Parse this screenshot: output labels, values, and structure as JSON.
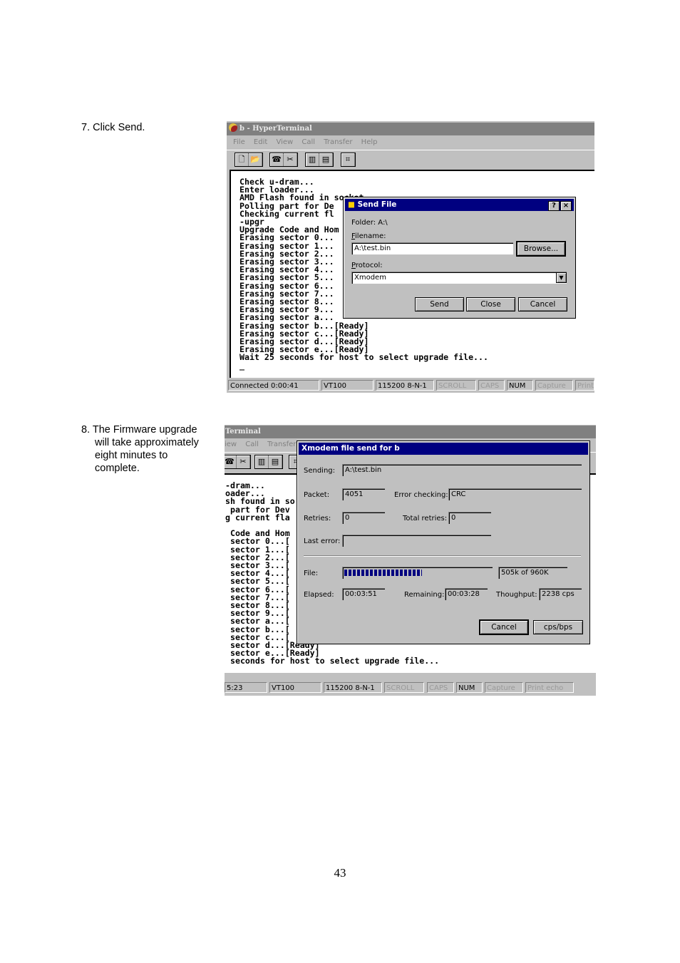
{
  "steps": {
    "step7": "7. Click Send.",
    "step8_line1": "8. The Firmware upgrade",
    "step8_line2": "will take approximately",
    "step8_line3": "eight minutes to",
    "step8_line4": "complete."
  },
  "page_number": "43",
  "screenshot1": {
    "window_title": "b - HyperTerminal",
    "menu": [
      "File",
      "Edit",
      "View",
      "Call",
      "Transfer",
      "Help"
    ],
    "terminal_lines": [
      "Check u-dram...",
      "Enter loader...",
      "AMD Flash found in socket",
      "Polling part for De",
      "Checking current fl",
      "-upgr",
      "Upgrade Code and Hom",
      "Erasing sector 0...",
      "Erasing sector 1...",
      "Erasing sector 2...",
      "Erasing sector 3...",
      "Erasing sector 4...",
      "Erasing sector 5...",
      "Erasing sector 6...",
      "Erasing sector 7...",
      "Erasing sector 8...",
      "Erasing sector 9...",
      "Erasing sector a...",
      "Erasing sector b...[Ready]",
      "Erasing sector c...[Ready]",
      "Erasing sector d...[Ready]",
      "Erasing sector e...[Ready]",
      "Wait 25 seconds for host to select upgrade file...",
      "_"
    ],
    "dialog": {
      "title": "Send File",
      "folder_label": "Folder: A:\\",
      "filename_label": "Filename:",
      "filename_value": "A:\\test.bin",
      "browse_button": "Browse...",
      "protocol_label": "Protocol:",
      "protocol_value": "Xmodem",
      "send_button": "Send",
      "close_button": "Close",
      "cancel_button": "Cancel"
    },
    "status": {
      "connected": "Connected 0:00:41",
      "emulation": "VT100",
      "settings": "115200 8-N-1",
      "scroll": "SCROLL",
      "caps": "CAPS",
      "num": "NUM",
      "capture": "Capture",
      "print": "Print"
    }
  },
  "screenshot2": {
    "window_title": "Terminal",
    "menu": [
      "iew",
      "Call",
      "Transfer"
    ],
    "terminal_lines": [
      "-dram...",
      "oader...",
      "sh found in so",
      " part for Dev",
      "g current fla",
      "",
      " Code and Hom",
      " sector 0...[",
      " sector 1...[",
      " sector 2...[",
      " sector 3...[",
      " sector 4...[",
      " sector 5...[",
      " sector 6...[",
      " sector 7...[",
      " sector 8...[",
      " sector 9...[",
      " sector a...[",
      " sector b...[",
      " sector c...[",
      " sector d...[Ready]",
      " sector e...[Ready]",
      " seconds for host to select upgrade file..."
    ],
    "dialog": {
      "title": "Xmodem file send for b",
      "sending_label": "Sending:",
      "sending_value": "A:\\test.bin",
      "packet_label": "Packet:",
      "packet_value": "4051",
      "error_checking_label": "Error checking:",
      "error_checking_value": "CRC",
      "retries_label": "Retries:",
      "retries_value": "0",
      "total_retries_label": "Total retries:",
      "total_retries_value": "0",
      "last_error_label": "Last error:",
      "last_error_value": "",
      "file_label": "File:",
      "file_progress_fraction": 0.53,
      "file_value": "505k of 960K",
      "elapsed_label": "Elapsed:",
      "elapsed_value": "00:03:51",
      "remaining_label": "Remaining:",
      "remaining_value": "00:03:28",
      "throughput_label": "Thoughput:",
      "throughput_value": "2238 cps",
      "cancel_button": "Cancel",
      "cps_button": "cps/bps"
    },
    "status": {
      "connected": "5:23",
      "emulation": "VT100",
      "settings": "115200 8-N-1",
      "scroll": "SCROLL",
      "caps": "CAPS",
      "num": "NUM",
      "capture": "Capture",
      "print": "Print echo"
    }
  }
}
